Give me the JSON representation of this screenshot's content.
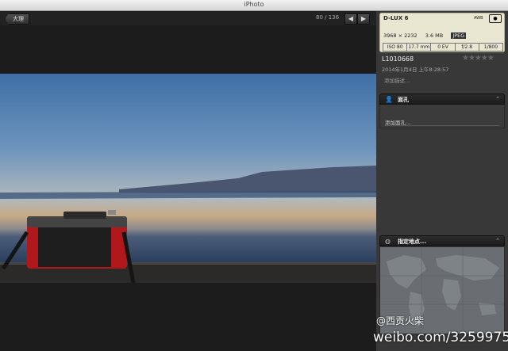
{
  "window": {
    "title": "iPhoto"
  },
  "toolbar": {
    "back_label": "大理",
    "counter": "80 / 136",
    "prev_icon": "◀",
    "next_icon": "▶"
  },
  "info": {
    "camera_model": "D-LUX 6",
    "white_balance": "AWB",
    "metering_icon": "●",
    "dimensions": "3968 × 2232",
    "file_size": "3.6 MB",
    "format": "JPEG",
    "iso": "ISO 80",
    "focal_length": "17.7 mm",
    "exposure_bias": "0 EV",
    "aperture": "f/2.8",
    "shutter": "1/800",
    "filename": "L1010668",
    "rating": "★★★★★",
    "date": "2014年1月4日 上午8:28:57",
    "description_placeholder": "添加描述..."
  },
  "faces": {
    "title": "面孔",
    "add_placeholder": "添加面孔...",
    "icon": "person-icon",
    "caret": "⌃"
  },
  "places": {
    "title": "指定地点...",
    "icon": "globe-icon",
    "caret": "⌃"
  },
  "watermark": {
    "handle": "@西贡火柴",
    "url": "weibo.com/325997575"
  },
  "colors": {
    "sidebar_bg": "#383838",
    "viewer_bg": "#1c1c1c",
    "exif_bg": "#e9e6d1"
  }
}
